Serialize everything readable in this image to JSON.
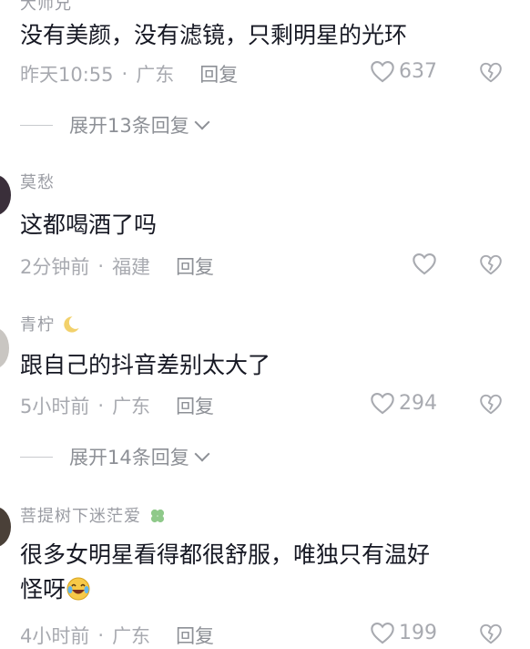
{
  "comments": [
    {
      "user": "大师兄",
      "text": "没有美颜，没有滤镜，只剩明星的光环",
      "time": "昨天10:55",
      "location": "广东",
      "reply_label": "回复",
      "likes": "637"
    },
    {
      "user": "莫愁",
      "text": "这都喝酒了吗",
      "time": "2分钟前",
      "location": "福建",
      "reply_label": "回复",
      "likes": ""
    },
    {
      "user": "青柠",
      "text": "跟自己的抖音差别太大了",
      "time": "5小时前",
      "location": "广东",
      "reply_label": "回复",
      "likes": "294"
    },
    {
      "user": "菩提树下迷茫爱",
      "text_line1": "很多女明星看得都很舒服，唯独只有温好",
      "text_line2": "怪呀",
      "time": "4小时前",
      "location": "广东",
      "reply_label": "回复",
      "likes": "199"
    }
  ],
  "expand_1": "展开13条回复",
  "expand_2": "展开14条回复",
  "separator": "·",
  "icons": {
    "like": "heart-outline-icon",
    "dislike": "broken-heart-icon",
    "expand": "chevron-down-icon"
  },
  "colors": {
    "text": "#161823",
    "meta": "#a8aab0"
  }
}
